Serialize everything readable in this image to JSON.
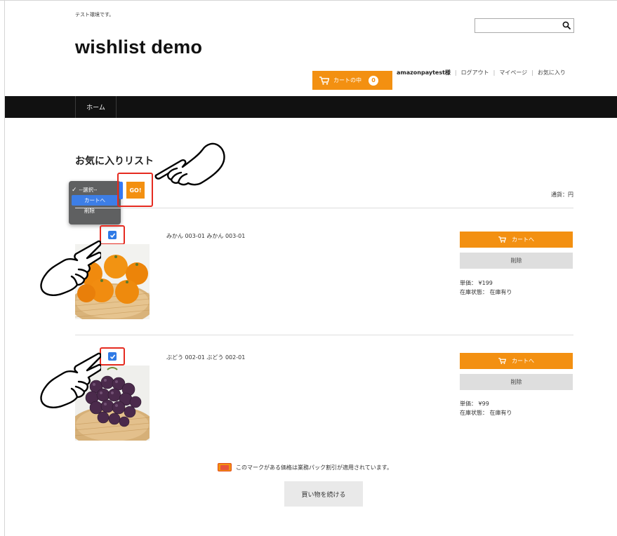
{
  "site": {
    "tagline": "テスト環境です。",
    "title": "wishlist demo"
  },
  "search": {
    "placeholder": ""
  },
  "header": {
    "cart_label": "カートの中",
    "cart_count": "0",
    "user_name": "amazonpaytest",
    "user_suffix": " 様",
    "logout": "ログアウト",
    "mypage": "マイページ",
    "favorites": "お気に入り"
  },
  "nav": {
    "home": "ホーム"
  },
  "wishlist": {
    "heading": "お気に入りリスト",
    "go_label": "GO!",
    "currency": "通貨：円",
    "dropdown_options": [
      {
        "label": "--選択--",
        "state": "selected"
      },
      {
        "label": "カートへ",
        "state": "highlighted"
      },
      {
        "label": "削除",
        "state": "normal"
      }
    ],
    "items": [
      {
        "name": "みかん 003-01 みかん 003-01",
        "cart_button": "カートへ",
        "delete_button": "削除",
        "unit_price": "単価： ¥199",
        "stock": "在庫状態： 在庫有り",
        "checked": true
      },
      {
        "name": "ぶどう 002-01 ぶどう 002-01",
        "cart_button": "カートへ",
        "delete_button": "削除",
        "unit_price": "単価： ¥99",
        "stock": "在庫状態： 在庫有り",
        "checked": true
      }
    ]
  },
  "footer": {
    "pack_note": "このマークがある価格は業務パック割引が適用されています。",
    "continue_button": "買い物を続ける"
  },
  "colors": {
    "accent": "#f39011",
    "nav_bg": "#111111",
    "annotation_red": "#e52b20",
    "checkbox_blue": "#2f7ae5"
  }
}
